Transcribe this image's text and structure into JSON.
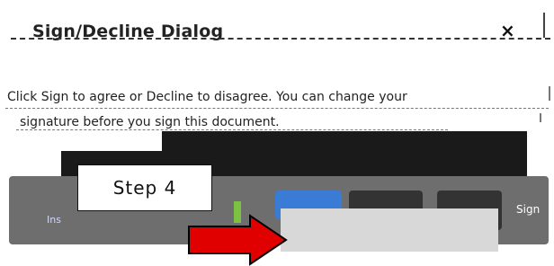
{
  "dialog": {
    "title": "Sign/Decline Dialog",
    "close_glyph": "×"
  },
  "instructions": {
    "line1": "Click Sign to agree or Decline to disagree. You can change your",
    "line2": "signature before you sign this document."
  },
  "toolbar": {
    "install_label": "Ins",
    "sign_label": "Sign"
  },
  "callout": {
    "step_label": "Step 4"
  },
  "colors": {
    "arrow": "#e00000",
    "accent_blue": "#3a7bd5",
    "accent_green": "#7cc142"
  },
  "icons": {
    "close": "close-icon",
    "arrow": "right-arrow-icon"
  }
}
